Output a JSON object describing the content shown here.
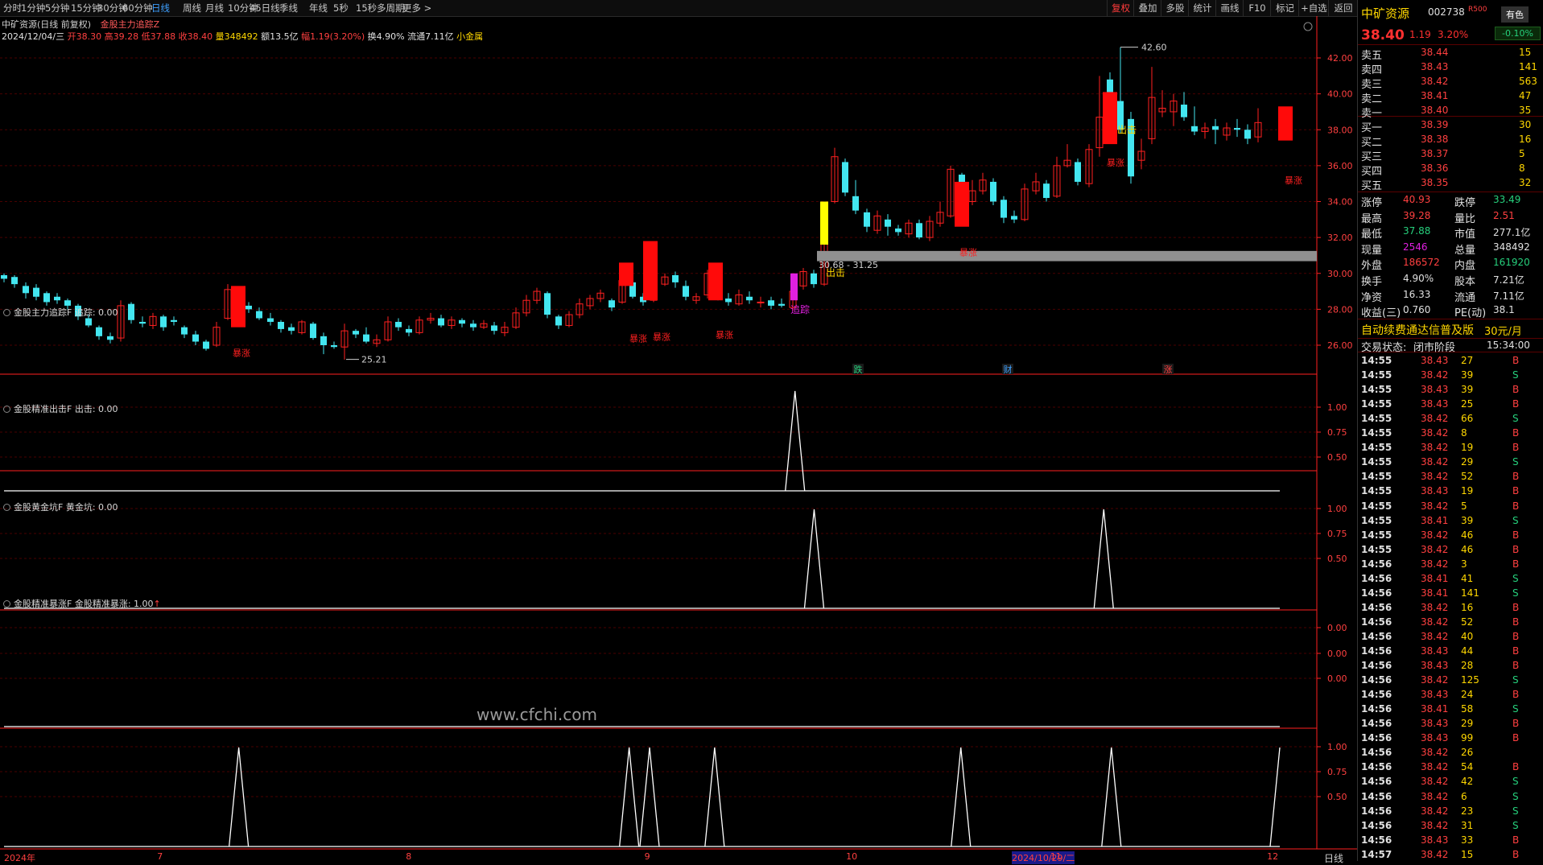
{
  "toolbar": {
    "timeframes": [
      "分时",
      "1分钟",
      "5分钟",
      "15分钟",
      "30分钟",
      "60分钟",
      "日线",
      "周线",
      "月线",
      "10分钟",
      "45日线",
      "季线",
      "年线",
      "5秒",
      "15秒",
      "多周期",
      "更多 >"
    ],
    "active_timeframe": "日线",
    "buttons": [
      "复权",
      "叠加",
      "多股",
      "统计",
      "画线",
      "F10",
      "标记",
      "+自选",
      "返回"
    ],
    "active_button": "复权"
  },
  "chart_header": {
    "stock": "中矿资源(日线 前复权)",
    "indicator": "金股主力追踪Z",
    "date": "2024/12/04/三",
    "open_label": "开",
    "open": "38.30",
    "high_label": "高",
    "high": "39.28",
    "low_label": "低",
    "low": "37.88",
    "close_label": "收",
    "close": "38.40",
    "vol_label": "量",
    "vol": "348492",
    "amount_label": "额",
    "amount": "13.5亿",
    "chg_label": "幅",
    "chg": "1.19(3.20%)",
    "turnover_label": "换",
    "turnover": "4.90%",
    "float_label": "流通",
    "float": "7.11亿",
    "sector": "小金属"
  },
  "main_chart": {
    "y_ticks": [
      "42.00",
      "40.00",
      "38.00",
      "36.00",
      "34.00",
      "32.00",
      "30.00",
      "28.00",
      "26.00"
    ],
    "labels": {
      "high": "42.60",
      "low": "25.21",
      "level": "30.68 - 31.25",
      "baozhang": "暴涨",
      "chuji": "出击",
      "zhuizong": "追踪"
    },
    "bottom_signals": [
      "跌",
      "财",
      "涨"
    ]
  },
  "panels": [
    {
      "title": "金股主力追踪F",
      "value_label": "追踪: 0.00",
      "y_ticks": [
        "1.00",
        "0.75",
        "0.50"
      ],
      "peaks": [
        0.62
      ]
    },
    {
      "title": "金股精准出击F",
      "value_label": "出击: 0.00",
      "y_ticks": [
        "1.00",
        "0.75",
        "0.50"
      ],
      "peaks": [
        0.635,
        0.862
      ]
    },
    {
      "title": "金股黄金坑F",
      "value_label": "黄金坑: 0.00",
      "y_ticks": [
        "0.00",
        "0.00",
        "0.00"
      ],
      "peaks": []
    },
    {
      "title": "金股精准暴涨F",
      "value_label": "金股精准暴涨: 1.00",
      "y_ticks": [
        "1.00",
        "0.75",
        "0.50"
      ],
      "peaks": [
        0.184,
        0.49,
        0.506,
        0.557,
        0.75,
        0.868
      ]
    }
  ],
  "watermark": "www.cfchi.com",
  "x_axis": {
    "ticks": [
      {
        "label": "2024年",
        "pos": 0.0
      },
      {
        "label": "7",
        "pos": 0.12
      },
      {
        "label": "8",
        "pos": 0.315
      },
      {
        "label": "9",
        "pos": 0.502
      },
      {
        "label": "10",
        "pos": 0.66
      },
      {
        "label": "2024/10/29/二",
        "pos": 0.79
      },
      {
        "label": "11",
        "pos": 0.82
      },
      {
        "label": "12",
        "pos": 0.99
      }
    ],
    "period": "日线"
  },
  "quote": {
    "name": "中矿资源",
    "code": "002738",
    "r_mark": "R500",
    "badge": "有色",
    "price": "38.40",
    "change": "1.19",
    "pct": "3.20%",
    "sector_pct": "-0.10%",
    "asks": [
      {
        "label": "卖五",
        "price": "38.44",
        "vol": "15"
      },
      {
        "label": "卖四",
        "price": "38.43",
        "vol": "141"
      },
      {
        "label": "卖三",
        "price": "38.42",
        "vol": "563"
      },
      {
        "label": "卖二",
        "price": "38.41",
        "vol": "47"
      },
      {
        "label": "卖一",
        "price": "38.40",
        "vol": "35"
      }
    ],
    "bids": [
      {
        "label": "买一",
        "price": "38.39",
        "vol": "30"
      },
      {
        "label": "买二",
        "price": "38.38",
        "vol": "16"
      },
      {
        "label": "买三",
        "price": "38.37",
        "vol": "5"
      },
      {
        "label": "买四",
        "price": "38.36",
        "vol": "8"
      },
      {
        "label": "买五",
        "price": "38.35",
        "vol": "32"
      }
    ],
    "stats": [
      {
        "k1": "涨停",
        "v1": "40.93",
        "k2": "跌停",
        "v2": "33.49"
      },
      {
        "k1": "最高",
        "v1": "39.28",
        "k2": "量比",
        "v2": "2.51"
      },
      {
        "k1": "最低",
        "v1": "37.88",
        "k2": "市值",
        "v2": "277.1亿"
      },
      {
        "k1": "现量",
        "v1": "2546",
        "k2": "总量",
        "v2": "348492"
      },
      {
        "k1": "外盘",
        "v1": "186572",
        "k2": "内盘",
        "v2": "161920"
      },
      {
        "k1": "换手",
        "v1": "4.90%",
        "k2": "股本",
        "v2": "7.21亿"
      },
      {
        "k1": "净资",
        "v1": "16.33",
        "k2": "流通",
        "v2": "7.11亿"
      },
      {
        "k1": "收益(三)",
        "v1": "0.760",
        "k2": "PE(动)",
        "v2": "38.1"
      }
    ],
    "promo": "自动续费通达信普及版",
    "promo_price": "30元/月",
    "status_label": "交易状态:",
    "status": "闭市阶段",
    "status_time": "15:34:00",
    "ticks": [
      [
        "14:55",
        "38.43",
        "27",
        "B"
      ],
      [
        "14:55",
        "38.42",
        "39",
        "S"
      ],
      [
        "14:55",
        "38.43",
        "39",
        "B"
      ],
      [
        "14:55",
        "38.43",
        "25",
        "B"
      ],
      [
        "14:55",
        "38.42",
        "66",
        "S"
      ],
      [
        "14:55",
        "38.42",
        "8",
        "B"
      ],
      [
        "14:55",
        "38.42",
        "19",
        "B"
      ],
      [
        "14:55",
        "38.42",
        "29",
        "S"
      ],
      [
        "14:55",
        "38.42",
        "52",
        "B"
      ],
      [
        "14:55",
        "38.43",
        "19",
        "B"
      ],
      [
        "14:55",
        "38.42",
        "5",
        "B"
      ],
      [
        "14:55",
        "38.41",
        "39",
        "S"
      ],
      [
        "14:55",
        "38.42",
        "46",
        "B"
      ],
      [
        "14:55",
        "38.42",
        "46",
        "B"
      ],
      [
        "14:56",
        "38.42",
        "3",
        "B"
      ],
      [
        "14:56",
        "38.41",
        "41",
        "S"
      ],
      [
        "14:56",
        "38.41",
        "141",
        "S"
      ],
      [
        "14:56",
        "38.42",
        "16",
        "B"
      ],
      [
        "14:56",
        "38.42",
        "52",
        "B"
      ],
      [
        "14:56",
        "38.42",
        "40",
        "B"
      ],
      [
        "14:56",
        "38.43",
        "44",
        "B"
      ],
      [
        "14:56",
        "38.43",
        "28",
        "B"
      ],
      [
        "14:56",
        "38.42",
        "125",
        "S"
      ],
      [
        "14:56",
        "38.43",
        "24",
        "B"
      ],
      [
        "14:56",
        "38.41",
        "58",
        "S"
      ],
      [
        "14:56",
        "38.43",
        "29",
        "B"
      ],
      [
        "14:56",
        "38.43",
        "99",
        "B"
      ],
      [
        "14:56",
        "38.42",
        "26",
        ""
      ],
      [
        "14:56",
        "38.42",
        "54",
        "B"
      ],
      [
        "14:56",
        "38.42",
        "42",
        "S"
      ],
      [
        "14:56",
        "38.42",
        "6",
        "S"
      ],
      [
        "14:56",
        "38.42",
        "23",
        "S"
      ],
      [
        "14:56",
        "38.42",
        "31",
        "S"
      ],
      [
        "14:56",
        "38.43",
        "33",
        "B"
      ],
      [
        "14:57",
        "38.42",
        "15",
        "B"
      ]
    ]
  },
  "colors": {
    "up": "#ff2020",
    "down": "#43e6f0",
    "price_up": "#ff4040",
    "grid": "#4a0000",
    "axis": "#ff2020"
  }
}
